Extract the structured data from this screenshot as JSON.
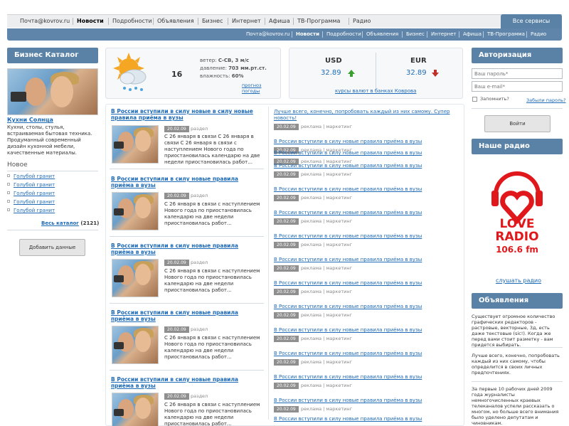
{
  "top_nav": {
    "items": [
      "Почта@kovrov.ru",
      "Новости",
      "Подробности",
      "Объявления",
      "Бизнес",
      "Интернет",
      "Афиша",
      "ТВ-Программа",
      "Радио"
    ],
    "all_services": "Все сервисы"
  },
  "sub_nav": {
    "items": [
      "Почта@kovrov.ru",
      "Новости",
      "Подробности",
      "Объявления",
      "Бизнес",
      "Интернет",
      "Афиша",
      "ТВ-Программа",
      "Радио"
    ]
  },
  "biz": {
    "header": "Бизнес Каталог",
    "company": "Кухни Солнца",
    "desc": "Кухни, столы, стулья, встраиваемая бытовая техника. Продуманный современный дизайн кухонной мебели, качественные материалы.",
    "new_title": "Новое",
    "new_items": [
      "Голубой гранит",
      "Голубой гранит",
      "Голубой гранит",
      "Голубой гранит",
      "Голубой гранит"
    ],
    "all_label": "Весь каталог",
    "all_count": "(2121)",
    "add_btn": "Добавить данные"
  },
  "weather": {
    "temp": "16",
    "wind_label": "ветер:",
    "wind": "С-СВ, 3 м/с",
    "pressure_label": "давление:",
    "pressure": "703 мм.рт.ст.",
    "humidity_label": "влажность:",
    "humidity": "60%",
    "forecast_link": "прогноз погоды"
  },
  "currency": {
    "usd_label": "USD",
    "usd_value": "32.89",
    "eur_label": "EUR",
    "eur_value": "32.89",
    "banks_link": "курсы валют в банках Коврова",
    "colors": {
      "up": "#3aa030",
      "down": "#c0302a"
    }
  },
  "news": {
    "title_first": "В России вступили в силу новые в силу новые правила приёма в вузы",
    "title": "В России вступили в силу новые правила приёма в вузы",
    "date": "20.02.09",
    "section": "раздел",
    "snippet_first": "С 26 января в связи С 26 января в связи С 26 января в связи с наступлением Нового года по приостановилась календарю на две недели приостановилась работ...",
    "snippet": "С 26 января в связи с наступлением Нового года по приостановилась календарю на две недели приостановилась работ..."
  },
  "news_list": {
    "lead": "Лучше всего, конечно, попробовать каждый из них самому. Супер новость!",
    "title": "В России вступили в силу новые правила приёма в вузы",
    "date": "20.02.09",
    "tag1": "реклама",
    "tag2": "маркетинг"
  },
  "auth": {
    "header": "Авторизация",
    "password_placeholder": "Ваш пароль*",
    "email_placeholder": "Ваш e-mail*",
    "remember": "Запомнить?",
    "forgot": "Забыли пароль?",
    "login_btn": "Войти"
  },
  "radio": {
    "header": "Наше радио",
    "logo_line1": "LOVE",
    "logo_line2": "RADIO",
    "logo_line3": "106.6 fm",
    "listen_link": "слушать радио",
    "colors": {
      "brand": "#e0181c"
    }
  },
  "ads": {
    "header": "Объявления",
    "items": [
      "Существует огромное количество графических редакторов - растровые, векторные, 3д, есть даже текстовые (sic!). Когда же перед вами стоит разметку - вам придется выбирать.",
      "Лучше всего, конечно, попробовать каждый из них самому, чтобы определится в своих личных предпочтениях.",
      "За первые 10 рабочих дней 2009 года журналисты немногочисленных краевых телеканалов успели рассказать о многом, но больше всего внимания было уделено депутатам и чиновникам."
    ]
  },
  "colors": {
    "accent": "#5a82a6",
    "link": "#1e6bb8"
  }
}
